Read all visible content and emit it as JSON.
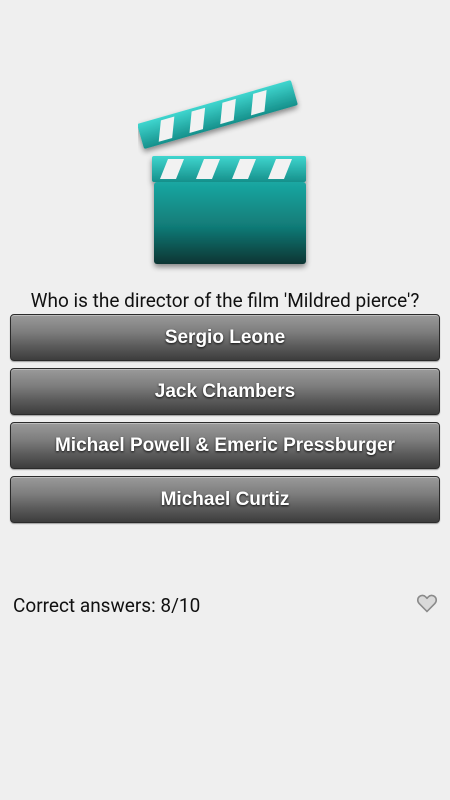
{
  "question": {
    "text": "Who is the director of the film 'Mildred pierce'?"
  },
  "answers": [
    {
      "label": "Sergio Leone"
    },
    {
      "label": "Jack Chambers"
    },
    {
      "label": "Michael Powell & Emeric Pressburger"
    },
    {
      "label": "Michael Curtiz"
    }
  ],
  "score": {
    "label": "Correct answers: 8/10"
  },
  "icons": {
    "header_image": "clapperboard-icon",
    "favorite": "heart-outline-icon"
  },
  "colors": {
    "background": "#efefef",
    "clapper_teal_light": "#2fc8c0",
    "clapper_teal_dark": "#0b3c3a",
    "button_top": "#9a9a9a",
    "button_bottom": "#3d3d3d"
  }
}
